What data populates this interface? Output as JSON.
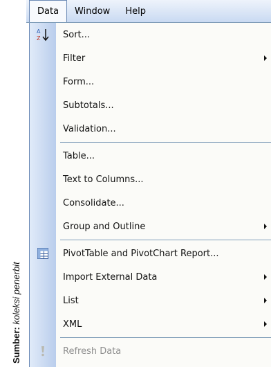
{
  "source": {
    "label": "Sumber:",
    "text": "koleksi penerbit"
  },
  "menubar": {
    "items": [
      "Data",
      "Window",
      "Help"
    ]
  },
  "data_menu": {
    "items": [
      {
        "label": "Sort...",
        "icon": "sort-az-icon",
        "submenu": false
      },
      {
        "label": "Filter",
        "submenu": true
      },
      {
        "label": "Form...",
        "submenu": false
      },
      {
        "label": "Subtotals...",
        "submenu": false
      },
      {
        "label": "Validation...",
        "submenu": false
      },
      {
        "label": "Table...",
        "submenu": false
      },
      {
        "label": "Text to Columns...",
        "submenu": false
      },
      {
        "label": "Consolidate...",
        "submenu": false
      },
      {
        "label": "Group and Outline",
        "submenu": true
      },
      {
        "label": "PivotTable and PivotChart Report...",
        "icon": "pivot-table-icon",
        "submenu": false
      },
      {
        "label": "Import External Data",
        "submenu": true
      },
      {
        "label": "List",
        "submenu": true
      },
      {
        "label": "XML",
        "submenu": true
      },
      {
        "label": "Refresh Data",
        "icon": "exclamation-icon",
        "submenu": false,
        "disabled": true
      }
    ]
  },
  "colors": {
    "menu_border": "#6b89b5",
    "gutter": "#c9daf2",
    "disabled_text": "#8f8f8f"
  }
}
